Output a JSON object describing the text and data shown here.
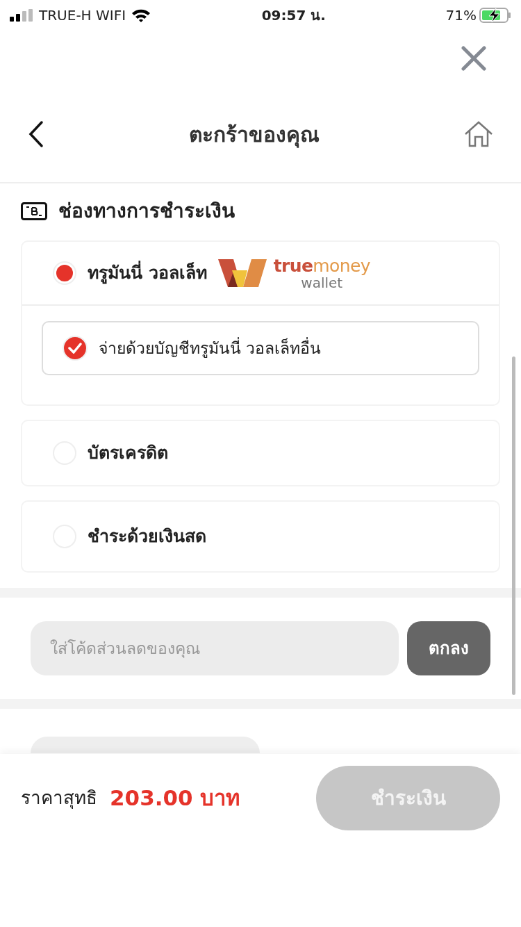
{
  "status_bar": {
    "carrier": "TRUE-H WIFI",
    "time": "09:57 น.",
    "battery": "71%"
  },
  "header": {
    "title": "ตะกร้าของคุณ"
  },
  "payment": {
    "title": "ช่องทางการชำระเงิน",
    "methods": [
      {
        "label": "ทรูมันนี่ วอลเล็ท",
        "selected": true,
        "logo": {
          "word_1": "true",
          "word_2": "money",
          "word_3": "wallet"
        },
        "sub_options": [
          {
            "label": "จ่ายด้วยบัญชีทรูมันนี่ วอลเล็ทอื่น",
            "checked": true
          }
        ]
      },
      {
        "label": "บัตรเครดิต",
        "selected": false
      },
      {
        "label": "ชำระด้วยเงินสด",
        "selected": false
      }
    ]
  },
  "promo": {
    "placeholder": "ใส่โค้ดส่วนลดของคุณ",
    "button": "ตกลง"
  },
  "footer": {
    "label": "ราคาสุทธิ",
    "amount": "203.00 บาท",
    "pay_button": "ชำระเงิน",
    "pay_disabled": true
  }
}
